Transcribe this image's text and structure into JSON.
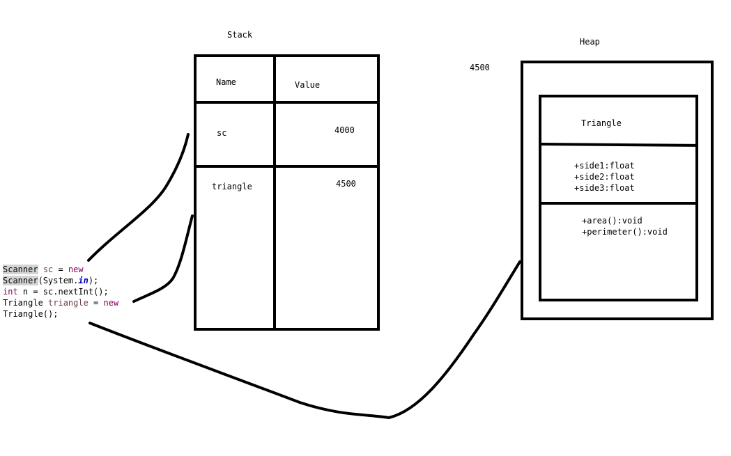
{
  "stack": {
    "title": "Stack",
    "header": {
      "name": "Name",
      "value": "Value"
    },
    "rows": [
      {
        "name": "sc",
        "value": "4000"
      },
      {
        "name": "triangle",
        "value": "4500"
      }
    ]
  },
  "heap": {
    "title": "Heap",
    "address": "4500",
    "object": {
      "class_name": "Triangle",
      "attributes": [
        "+side1:float",
        "+side2:float",
        "+side3:float"
      ],
      "methods": [
        "+area():void",
        "+perimeter():void"
      ]
    }
  },
  "code": {
    "line1": {
      "type": "Scanner",
      "var": "sc",
      "assign": " = ",
      "kw": "new"
    },
    "line2": {
      "type": "Scanner",
      "open": "(System.",
      "field": "in",
      "close": ");"
    },
    "line3": {
      "kw": "int",
      "rest": " n = sc.nextInt();"
    },
    "line4": {
      "type": "Triangle",
      "var": "triangle",
      "assign": " = ",
      "kw": "new"
    },
    "line5": {
      "text": "Triangle();"
    }
  }
}
